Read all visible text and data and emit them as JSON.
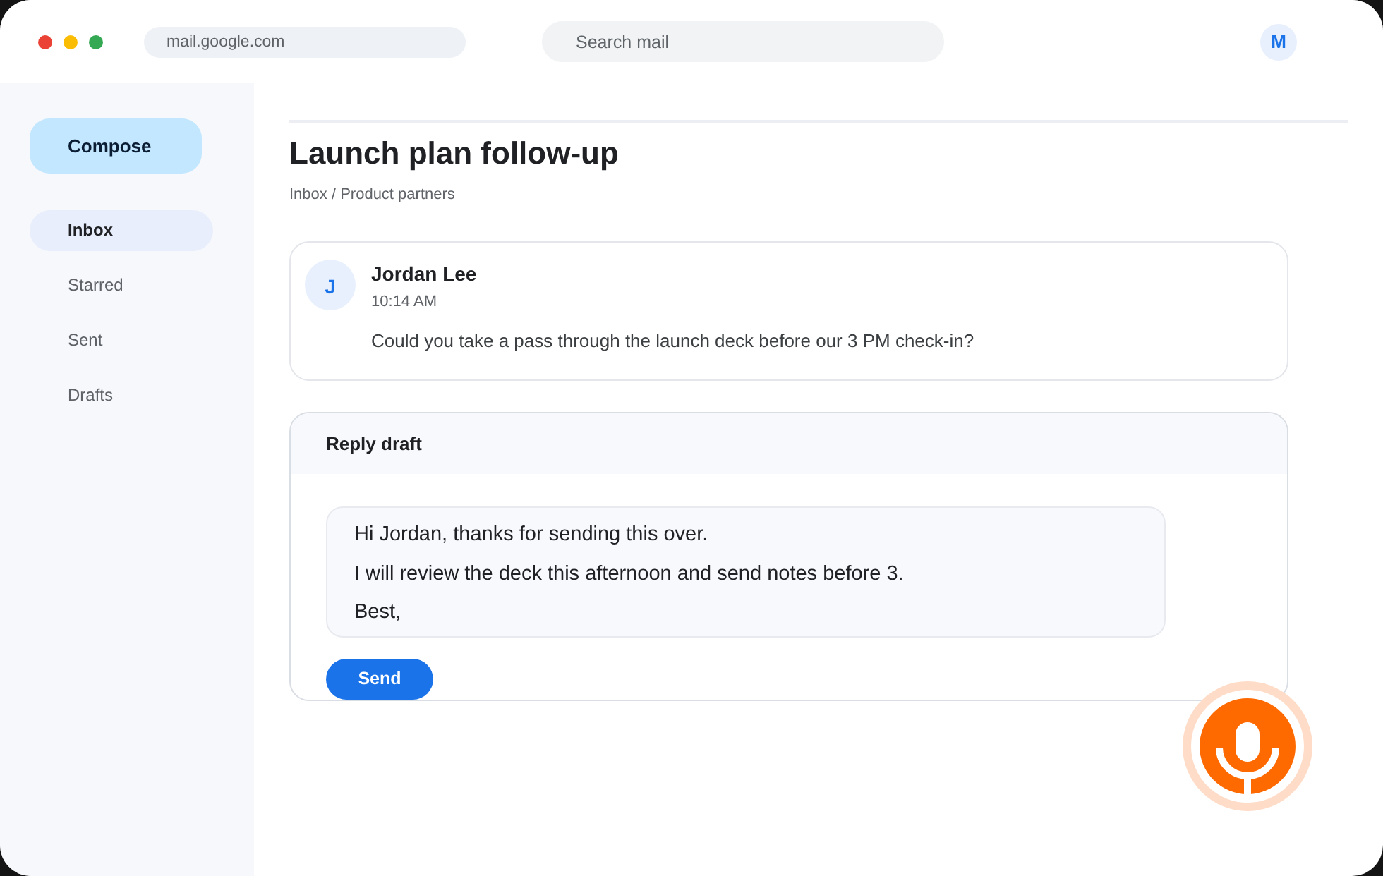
{
  "browser": {
    "address": "mail.google.com",
    "search": {
      "placeholder": "Search mail"
    },
    "account_initial": "M"
  },
  "sidebar": {
    "compose": "Compose",
    "items": [
      {
        "label": "Inbox",
        "selected": true
      },
      {
        "label": "Starred",
        "selected": false
      },
      {
        "label": "Sent",
        "selected": false
      },
      {
        "label": "Drafts",
        "selected": false
      }
    ]
  },
  "thread": {
    "title": "Launch plan follow-up",
    "breadcrumb": "Inbox / Product partners",
    "messages": [
      {
        "initial": "J",
        "sender": "Jordan Lee",
        "time": "10:14 AM",
        "body": "Could you take a pass through the launch deck before our 3 PM check-in?"
      }
    ]
  },
  "reply": {
    "title": "Reply draft",
    "lines": [
      "Hi Jordan, thanks for sending this over.",
      "I will review the deck this afternoon and send notes before 3.",
      "Best,"
    ],
    "send": "Send"
  }
}
